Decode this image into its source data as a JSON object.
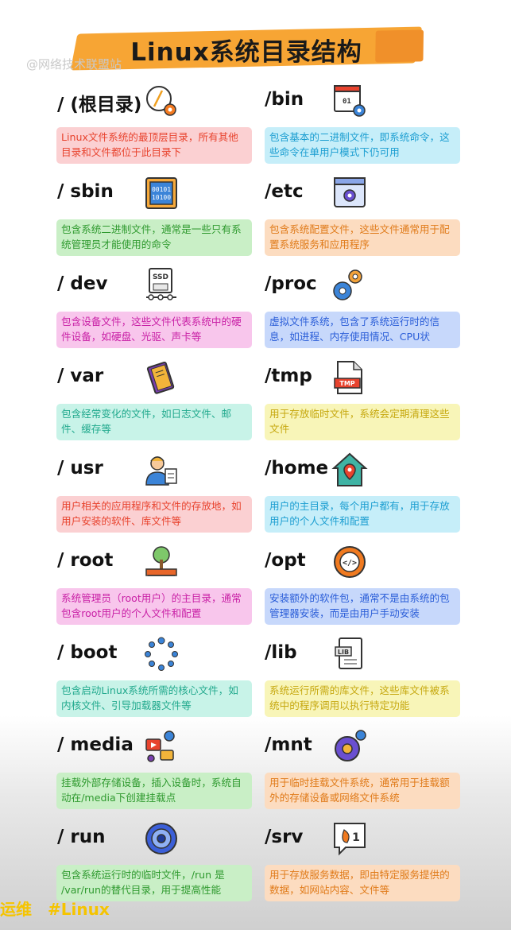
{
  "header": {
    "title": "Linux系统目录结构",
    "watermark": "@网络技术联盟站"
  },
  "footer": {
    "tag1": "运维",
    "tag2": "#Linux"
  },
  "left": [
    {
      "name": "/ (根目录)",
      "icon": "root-dir-icon",
      "desc": "Linux文件系统的最顶层目录，所有其他目录和文件都位于此目录下",
      "bg": "#fbd0d2",
      "fg": "#e8432e"
    },
    {
      "name": "/ sbin",
      "icon": "binary-chip-icon",
      "desc": "包含系统二进制文件，通常是一些只有系统管理员才能使用的命令",
      "bg": "#c9efc6",
      "fg": "#2f9a2f"
    },
    {
      "name": "/ dev",
      "icon": "ssd-icon",
      "desc": "包含设备文件，这些文件代表系统中的硬件设备，如硬盘、光驱、声卡等",
      "bg": "#f8c6ec",
      "fg": "#c921a6"
    },
    {
      "name": "/ var",
      "icon": "book-icon",
      "desc": "包含经常变化的文件，如日志文件、邮件、缓存等",
      "bg": "#c8f3e8",
      "fg": "#21a98d"
    },
    {
      "name": "/ usr",
      "icon": "user-icon",
      "desc": "用户相关的应用程序和文件的存放地，如用户安装的软件、库文件等",
      "bg": "#fbd0d2",
      "fg": "#e8432e"
    },
    {
      "name": "/ root",
      "icon": "tree-icon",
      "desc": "系统管理员（root用户）的主目录，通常包含root用户的个人文件和配置",
      "bg": "#f8c6ec",
      "fg": "#c921a6"
    },
    {
      "name": "/ boot",
      "icon": "loading-icon",
      "desc": "包含启动Linux系统所需的核心文件，如内核文件、引导加载器文件等",
      "bg": "#c8f3e8",
      "fg": "#21a98d"
    },
    {
      "name": "/ media",
      "icon": "media-icon",
      "desc": "挂载外部存储设备，插入设备时，系统自动在/media下创建挂载点",
      "bg": "#c9efc6",
      "fg": "#2f9a2f"
    },
    {
      "name": "/ run",
      "icon": "target-icon",
      "desc": "包含系统运行时的临时文件，/run 是 /var/run的替代目录，用于提高性能",
      "bg": "#c9efc6",
      "fg": "#2f9a2f"
    }
  ],
  "right": [
    {
      "name": "/bin",
      "icon": "binary-window-icon",
      "desc": "包含基本的二进制文件，即系统命令，这些命令在单用户模式下仍可用",
      "bg": "#c6eef9",
      "fg": "#1c9ed1"
    },
    {
      "name": "/etc",
      "icon": "config-window-icon",
      "desc": "包含系统配置文件，这些文件通常用于配置系统服务和应用程序",
      "bg": "#fcdcc0",
      "fg": "#e07b1a"
    },
    {
      "name": "/proc",
      "icon": "gears-icon",
      "desc": "虚拟文件系统，包含了系统运行时的信息，如进程、内存使用情况、CPU状",
      "bg": "#c7d8fb",
      "fg": "#2b5ed8"
    },
    {
      "name": "/tmp",
      "icon": "tmp-file-icon",
      "desc": "用于存放临时文件，系统会定期清理这些文件",
      "bg": "#f8f5b8",
      "fg": "#c6a80f"
    },
    {
      "name": "/home",
      "icon": "home-icon",
      "desc": "用户的主目录，每个用户都有，用于存放用户的个人文件和配置",
      "bg": "#c6eef9",
      "fg": "#1c9ed1"
    },
    {
      "name": "/opt",
      "icon": "code-gear-icon",
      "desc": "安装额外的软件包，通常不是由系统的包管理器安装，而是由用户手动安装",
      "bg": "#c7d8fb",
      "fg": "#2b5ed8"
    },
    {
      "name": "/lib",
      "icon": "lib-file-icon",
      "desc": "系统运行所需的库文件，这些库文件被系统中的程序调用以执行特定功能",
      "bg": "#f8f5b8",
      "fg": "#c6a80f"
    },
    {
      "name": "/mnt",
      "icon": "mount-gear-icon",
      "desc": "用于临时挂载文件系统，通常用于挂载额外的存储设备或网络文件系统",
      "bg": "#fcdcc0",
      "fg": "#e07b1a"
    },
    {
      "name": "/srv",
      "icon": "service-icon",
      "desc": "用于存放服务数据，即由特定服务提供的数据，如网站内容、文件等",
      "bg": "#fcdcc0",
      "fg": "#e07b1a"
    }
  ]
}
